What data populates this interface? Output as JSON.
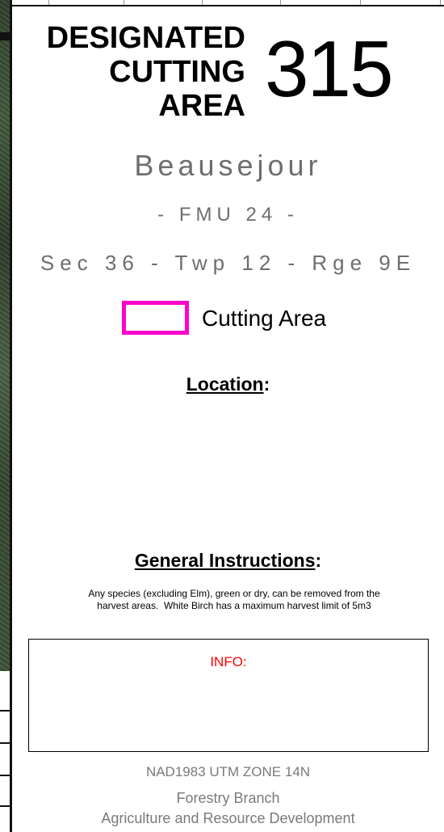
{
  "title": {
    "line1": "DESIGNATED",
    "line2": "CUTTING",
    "line3": "AREA"
  },
  "area_number": "315",
  "site_name": "Beausejour",
  "fmu": "- FMU 24 -",
  "legal_description": "Sec 36 - Twp 12 - Rge 9E",
  "legend": {
    "label": "Cutting Area",
    "color": "#ff00cc"
  },
  "location": {
    "heading_word": "Location",
    "colon": ":"
  },
  "general_instructions": {
    "heading_word": "General Instructions",
    "colon": ":",
    "line1": "Any species (excluding Elm), green or dry, can be removed from the",
    "line2": "harvest areas.  White Birch has a maximum harvest limit of 5m3"
  },
  "info": {
    "label": "INFO:",
    "color": "#ff0000"
  },
  "footer": {
    "datum": "NAD1983 UTM ZONE 14N",
    "branch": "Forestry Branch",
    "department": "Agriculture and Resource Development"
  }
}
